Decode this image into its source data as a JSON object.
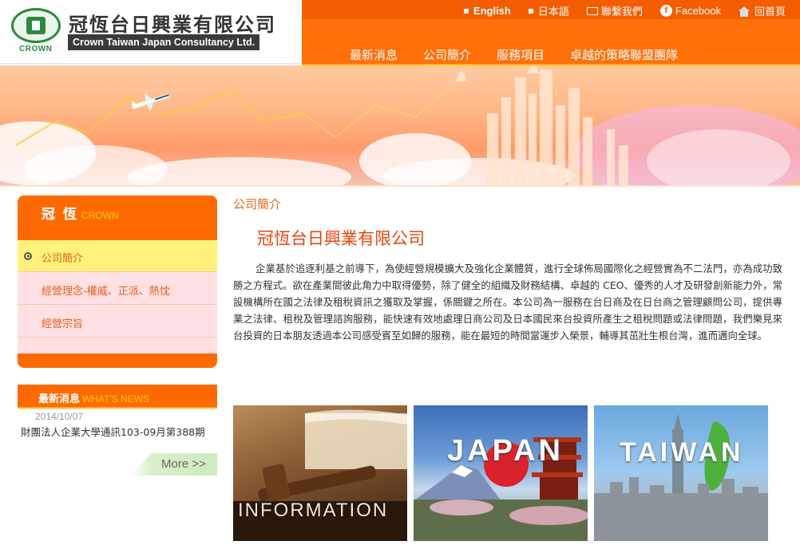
{
  "brand": {
    "name_cn": "冠恆台日興業有限公司",
    "name_en": "Crown Taiwan Japan Consultancy Ltd.",
    "crown": "CROWN"
  },
  "topnav": {
    "english": "English",
    "japanese": "日本語",
    "contact": "聯繫我們",
    "facebook": "Facebook",
    "home": "回首頁"
  },
  "mainnav": {
    "items": [
      "最新消息",
      "公司簡介",
      "服務項目",
      "卓越的策略聯盟團隊"
    ],
    "active": "公司簡介"
  },
  "sidebar": {
    "title": "冠 恆",
    "title_en": "CROWN",
    "items": [
      "公司簡介",
      "經營理念-權威、正派、熱忱",
      "經營宗旨"
    ]
  },
  "news": {
    "title": "最新消息",
    "title_en": "WHAT'S NEWS",
    "date": "2014/10/07",
    "text": "財團法人企業大學通訊103-09月第388期",
    "more": "More >>"
  },
  "content": {
    "crumb": "公司簡介",
    "company_title": "冠恆台日興業有限公司",
    "intro": "企業基於追逐利基之前導下，為使經營規模擴大及強化企業體質，進行全球佈局國際化之經營實為不二法門，亦為成功致勝之方程式。欲在產業間彼此角力中取得優勢，除了健全的組織及財務結構、卓越的 CEO、優秀的人才及研發創新能力外，常設機構所在國之法律及租稅資訊之獲取及掌握，係關鍵之所在。本公司為一服務在台日商及在日台商之管理顧問公司，提供專業之法律、租稅及管理諮詢服務，能快速有效地處理日商公司及日本國民來台投資所產生之租稅問題或法律問題，我們樂見來台投資的日本朋友透過本公司感受賓至如歸的服務，能在最短的時間當運步入榮景，輔導其茁壯生根台灣，進而邁向全球。"
  },
  "tiles": {
    "info": "INFORMATION",
    "japan": "JAPAN",
    "taiwan": "TAIWAN"
  },
  "colors": {
    "orange": "#ff6f0a",
    "accent_yellow": "#ffd000",
    "logo_green": "#2d8a3a"
  }
}
